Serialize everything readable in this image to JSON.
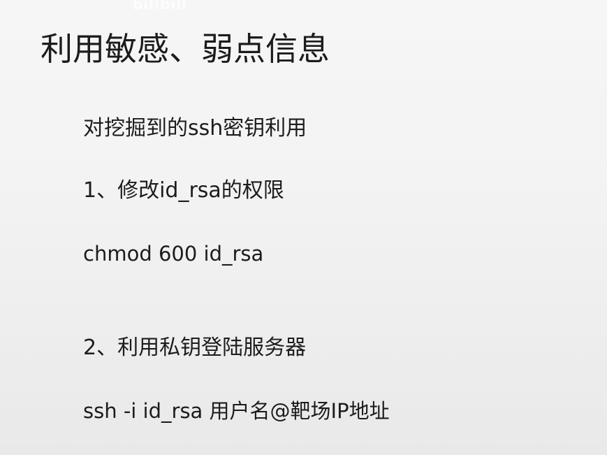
{
  "slide": {
    "title": "利用敏感、弱点信息",
    "lines": [
      "对挖掘到的ssh密钥利用",
      "1、修改id_rsa的权限",
      "chmod 600 id_rsa",
      "2、利用私钥登陆服务器",
      "ssh -i id_rsa 用户名@靶场IP地址"
    ]
  }
}
